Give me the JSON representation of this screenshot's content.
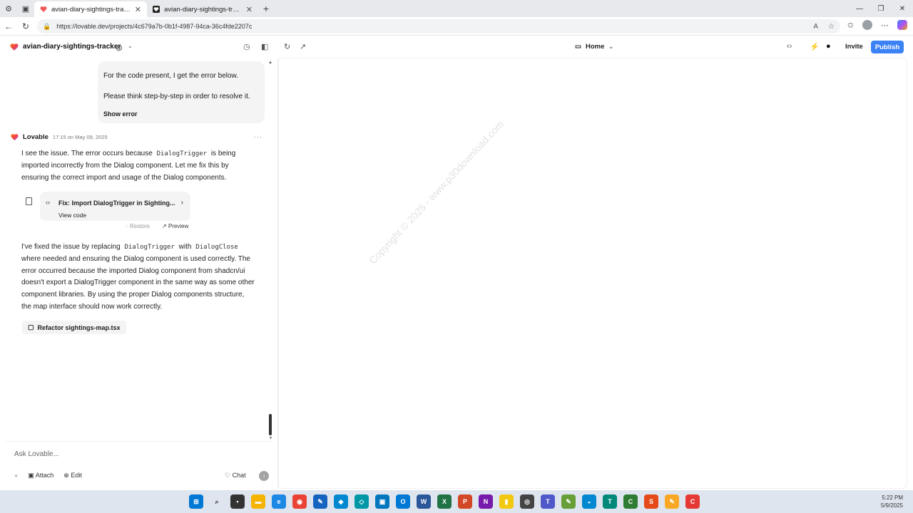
{
  "browser": {
    "tabs": [
      {
        "title": "avian-diary-sightings-tracker - Lo",
        "active": true
      },
      {
        "title": "avian-diary-sightings-tracker",
        "active": false
      }
    ],
    "url": "https://lovable.dev/projects/4c679a7b-0b1f-4987-94ca-36c4fde2207c"
  },
  "header": {
    "project_name": "avian-diary-sightings-tracker",
    "view_selector": "Home",
    "invite_label": "Invite",
    "publish_label": "Publish"
  },
  "chat": {
    "user_message": {
      "line1": "For the code present, I get the error below.",
      "line2": "Please think step-by-step in order to resolve it.",
      "show_error": "Show error"
    },
    "assistant": {
      "name": "Lovable",
      "timestamp": "17:15 on May 09, 2025",
      "para1_a": "I see the issue. The error occurs because",
      "para1_code": "DialogTrigger",
      "para1_b": "is being",
      "para1_line2": "imported incorrectly from the Dialog component. Let me fix this by",
      "para1_line3": "ensuring the correct import and usage of the Dialog components.",
      "card_title": "Fix: Import DialogTrigger in Sighting...",
      "card_view_code": "View code",
      "restore": "Restore",
      "preview": "Preview",
      "para2_a": "I've fixed the issue by replacing",
      "para2_code1": "DialogTrigger",
      "para2_with": "with",
      "para2_code2": "DialogClose",
      "para2_line2": "where needed and ensuring the Dialog component is used correctly. The",
      "para2_line3": "error occurred because the imported Dialog component from shadcn/ui",
      "para2_line4": "doesn't export a DialogTrigger component in the same way as some other",
      "para2_line5": "component libraries. By using the proper Dialog components structure,",
      "para2_line6": "the map interface should now work correctly.",
      "refactor_label": "Refactor sightings-map.tsx"
    },
    "input_placeholder": "Ask Lovable...",
    "attach_label": "Attach",
    "edit_label": "Edit",
    "chat_label": "Chat"
  },
  "preview": {
    "watermark": "Copyright © 2025 - www.p30download.com"
  },
  "taskbar": {
    "time": "5:22 PM",
    "date": "5/9/2025"
  },
  "colors": {
    "accent": "#3b82f6",
    "bubble": "#f4f4f5"
  }
}
